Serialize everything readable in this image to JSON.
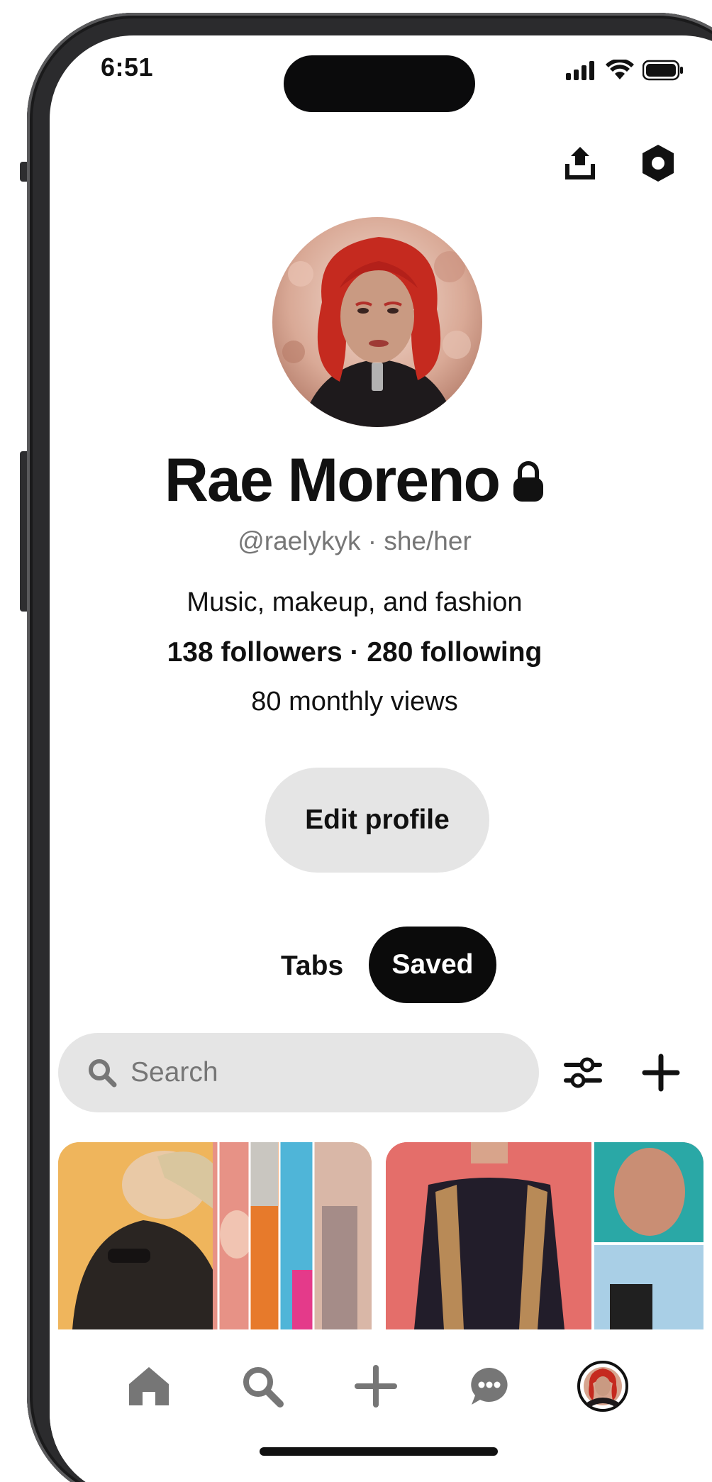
{
  "status_bar": {
    "time": "6:51"
  },
  "header_actions": {
    "share_icon": "share-upload-icon",
    "settings_icon": "settings-hexagon-icon"
  },
  "profile": {
    "name": "Rae Moreno",
    "lock_icon": "lock-icon",
    "handle_line": "@raelykyk · she/her",
    "bio": "Music, makeup, and fashion",
    "stats": "138 followers · 280 following",
    "views": "80 monthly views",
    "edit_button": "Edit profile"
  },
  "tabs": {
    "items": [
      {
        "label": "Tabs",
        "active": false
      },
      {
        "label": "Saved",
        "active": true
      }
    ]
  },
  "search": {
    "placeholder": "Search",
    "filter_icon": "sliders-filter-icon",
    "add_icon": "plus-icon"
  },
  "bottom_nav": {
    "items": [
      {
        "name": "home",
        "icon": "home-icon"
      },
      {
        "name": "search",
        "icon": "search-icon"
      },
      {
        "name": "create",
        "icon": "plus-icon"
      },
      {
        "name": "messages",
        "icon": "chat-bubble-icon"
      },
      {
        "name": "profile",
        "icon": "avatar"
      }
    ]
  },
  "colors": {
    "text": "#111111",
    "muted": "#767676",
    "pill_gray": "#e5e5e5",
    "active_tab": "#0b0b0b"
  }
}
